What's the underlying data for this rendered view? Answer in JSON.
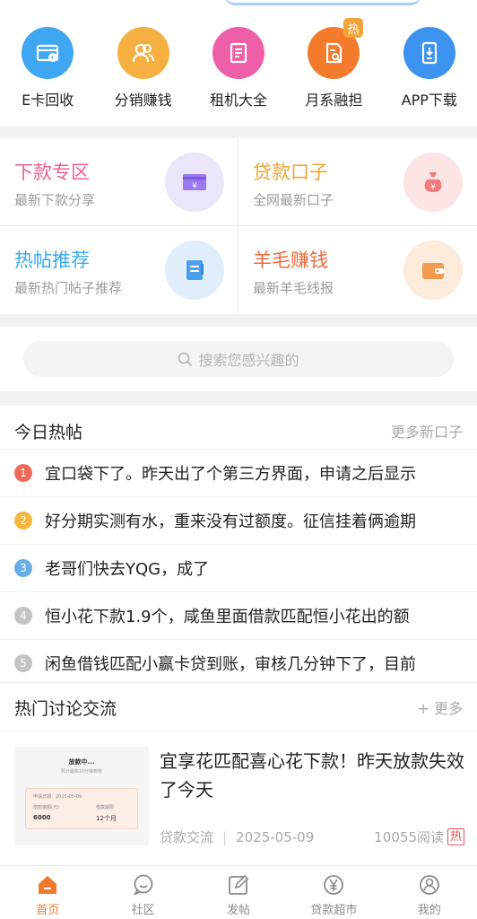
{
  "quick_links": [
    {
      "label": "E卡回收",
      "icon": "card-recycle-icon",
      "color": "#3fa6f2"
    },
    {
      "label": "分销赚钱",
      "icon": "people-icon",
      "color": "#f5b041"
    },
    {
      "label": "租机大全",
      "icon": "book-icon",
      "color": "#ef5fa7"
    },
    {
      "label": "月系融担",
      "icon": "document-search-icon",
      "color": "#f47a2c",
      "badge": "热"
    },
    {
      "label": "APP下载",
      "icon": "phone-download-icon",
      "color": "#3d93f0"
    }
  ],
  "features": [
    {
      "title": "下款专区",
      "subtitle": "最新下款分享",
      "title_color": "#ec5f8d",
      "icon": "cash-card-icon",
      "icon_bg": "#ece6fb",
      "icon_color": "#9a78ee"
    },
    {
      "title": "贷款口子",
      "subtitle": "全网最新口子",
      "title_color": "#f0a634",
      "icon": "money-bag-icon",
      "icon_bg": "#fde5e5",
      "icon_color": "#f17a7a"
    },
    {
      "title": "热帖推荐",
      "subtitle": "最新热门帖子推荐",
      "title_color": "#3aa9ef",
      "icon": "notebook-icon",
      "icon_bg": "#e1effc",
      "icon_color": "#4aa0ef"
    },
    {
      "title": "羊毛赚钱",
      "subtitle": "最新羊毛线报",
      "title_color": "#ef6a3a",
      "icon": "wallet-icon",
      "icon_bg": "#fdebdc",
      "icon_color": "#f39a50"
    }
  ],
  "search": {
    "placeholder": "搜索您感兴趣的"
  },
  "today_hot": {
    "title": "今日热帖",
    "more": "更多新口子",
    "items": [
      {
        "rank": "1",
        "text": "宜口袋下了。昨天出了个第三方界面，申请之后显示",
        "color": "#ef6a5a"
      },
      {
        "rank": "2",
        "text": "好分期实测有水，重来没有过额度。征信挂着俩逾期",
        "color": "#f4b63e"
      },
      {
        "rank": "3",
        "text": "老哥们快去YQG，成了",
        "color": "#6aaee8"
      },
      {
        "rank": "4",
        "text": "恒小花下款1.9个，咸鱼里面借款匹配恒小花出的额",
        "color": "#c4c4c4"
      },
      {
        "rank": "5",
        "text": "闲鱼借钱匹配小赢卡贷到账，审核几分钟下了，目前",
        "color": "#c4c4c4"
      }
    ]
  },
  "discussion": {
    "title": "热门讨论交流",
    "more": "+ 更多",
    "article": {
      "title": "宜享花匹配喜心花下款！昨天放款失效了今天",
      "category": "贷款交流",
      "date": "2025-05-09",
      "reads": "10055阅读",
      "tag": "热",
      "thumb": {
        "heading": "放款中...",
        "sub": "预计最快10分钟到账",
        "line1": "申请日期：2025-05-09",
        "amount_label": "借款金额(元)",
        "amount": "6000",
        "term_label": "借款期限",
        "term": "12个月"
      }
    }
  },
  "tabs": [
    {
      "label": "首页",
      "icon": "home-icon",
      "active": true
    },
    {
      "label": "社区",
      "icon": "chat-icon"
    },
    {
      "label": "发帖",
      "icon": "edit-icon"
    },
    {
      "label": "贷款超市",
      "icon": "yen-icon"
    },
    {
      "label": "我的",
      "icon": "user-icon"
    }
  ],
  "colors": {
    "accent": "#f07a2a",
    "tab_inactive": "#8a8a8a"
  }
}
